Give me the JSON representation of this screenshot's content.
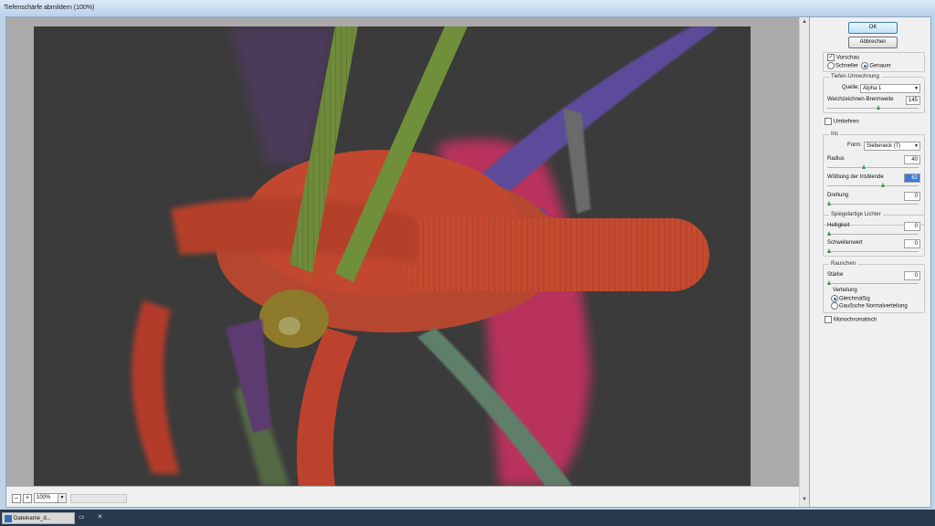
{
  "window": {
    "title": "Tiefenschärfe abmildern (100%)"
  },
  "preview": {
    "zoom": "100%",
    "zoom_out": "–",
    "zoom_in": "+"
  },
  "buttons": {
    "ok": "OK",
    "cancel": "Abbrechen"
  },
  "preview_group": {
    "preview_label": "Vorschau",
    "preview_checked": true,
    "faster_label": "Schneller",
    "accurate_label": "Genauer",
    "selected": "accurate"
  },
  "depth_map": {
    "title": "Tiefen-Umrechnung",
    "source_label": "Quelle:",
    "source_value": "Alpha 1",
    "blur_focal_label": "Weichzeichnen-Brennweite",
    "blur_focal_value": "145",
    "blur_focal_fraction": 0.57,
    "invert_label": "Umkehren"
  },
  "iris": {
    "title": "Iris",
    "shape_label": "Form:",
    "shape_value": "Siebeneck (7)",
    "radius_label": "Radius",
    "radius_value": "40",
    "radius_fraction": 0.4,
    "curvature_label": "Wölbung der Irisblende",
    "curvature_value": "62",
    "curvature_fraction": 0.62,
    "rotation_label": "Drehung",
    "rotation_value": "0",
    "rotation_fraction": 0.0
  },
  "specular": {
    "title": "Spiegelartige Lichter",
    "brightness_label": "Helligkeit",
    "brightness_value": "0",
    "brightness_fraction": 0.0,
    "threshold_label": "Schwellenwert",
    "threshold_value": "0",
    "threshold_fraction": 0.0
  },
  "noise": {
    "title": "Rauschen",
    "amount_label": "Stärke",
    "amount_value": "0",
    "amount_fraction": 0.0,
    "distribution_title": "Verteilung",
    "uniform_label": "Gleichmäßig",
    "gaussian_label": "Gaußsche Normalverteilung",
    "selected": "uniform",
    "mono_label": "Monochromatisch"
  },
  "taskbar": {
    "item": "Dateiname_d..."
  },
  "colors": {
    "accent": "#3a7bd5",
    "slider_thumb": "#37a04a"
  }
}
